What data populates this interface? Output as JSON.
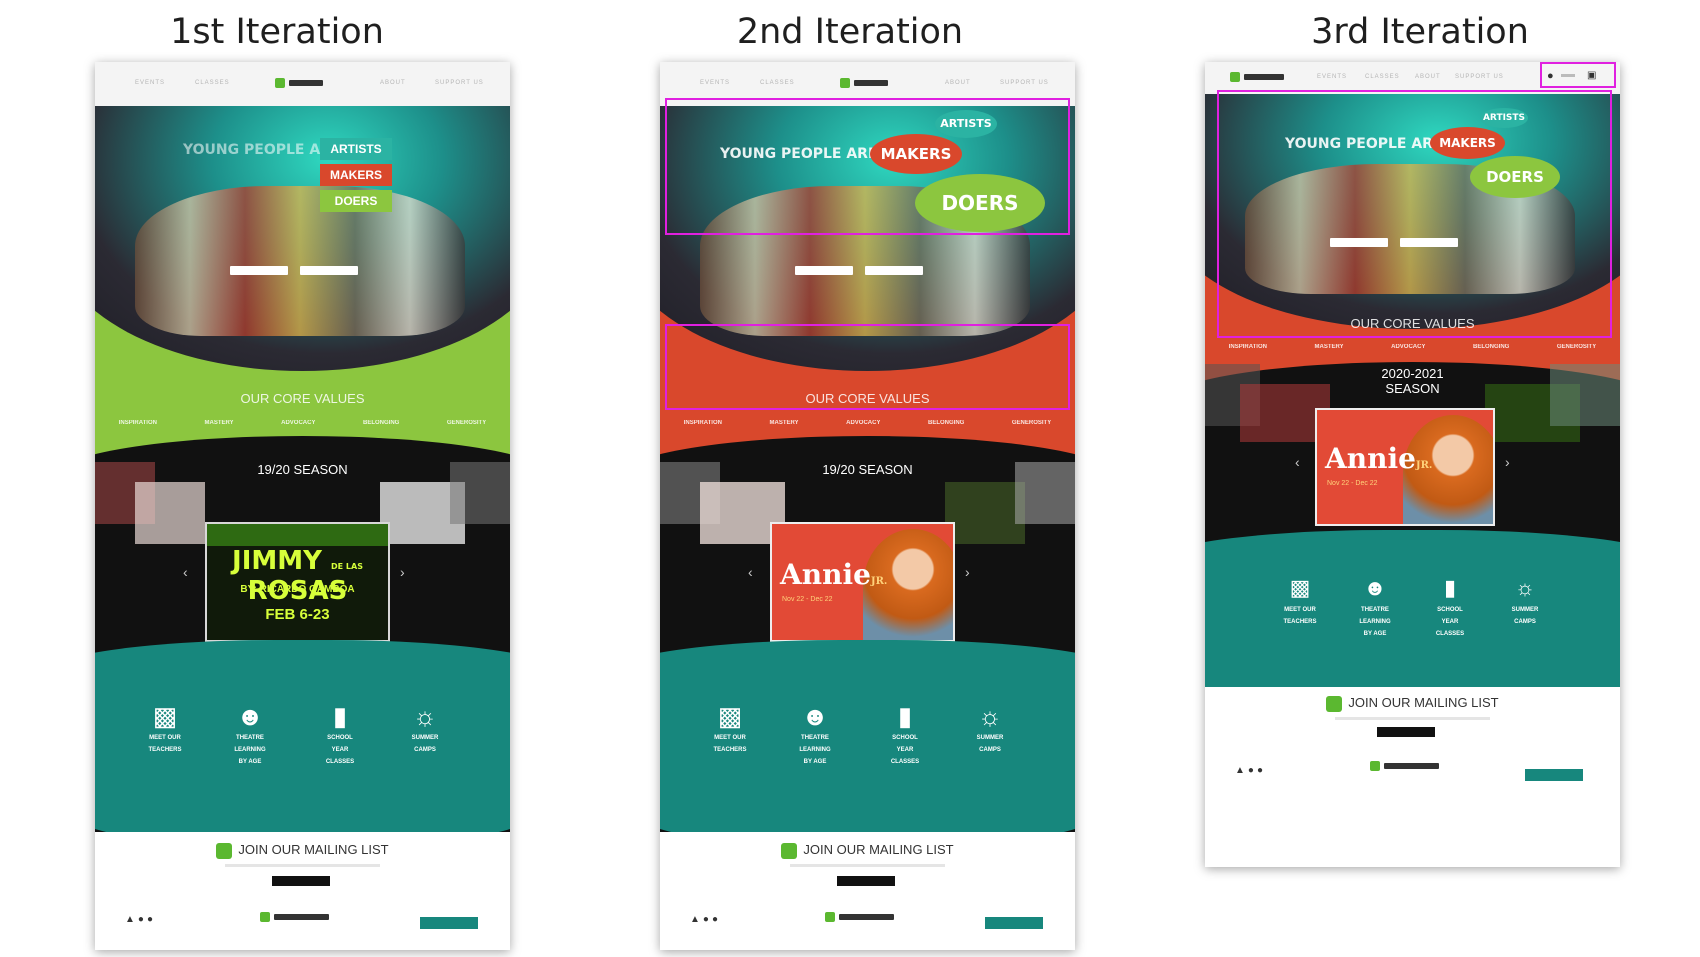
{
  "columns": [
    {
      "title": "1st Iteration"
    },
    {
      "title": "2nd Iteration"
    },
    {
      "title": "3rd Iteration"
    }
  ],
  "hero": {
    "prefix": "YOUNG PEOPLE ARE",
    "words": [
      "ARTISTS",
      "MAKERS",
      "DOERS"
    ]
  },
  "values": {
    "title": "OUR CORE VALUES",
    "items": [
      "INSPIRATION",
      "MASTERY",
      "ADVOCACY",
      "BELONGING",
      "GENEROSITY"
    ]
  },
  "season": {
    "v1": "19/20 SEASON",
    "v2": "19/20 SEASON",
    "v3_line1": "2020-2021",
    "v3_line2": "SEASON"
  },
  "posters": {
    "jimmy_title": "JIMMY",
    "jimmy_sub": "DE LAS",
    "jimmy_title2": "ROSAS",
    "jimmy_by": "BY: RICARDO GAMBOA",
    "jimmy_dates": "FEB 6-23",
    "annie_title": "Annie",
    "annie_suffix": "JR.",
    "annie_dates": "Nov 22 - Dec 22"
  },
  "features": [
    {
      "label1": "MEET OUR",
      "label2": "TEACHERS",
      "label3": "",
      "icon": "teacher-icon"
    },
    {
      "label1": "THEATRE",
      "label2": "LEARNING",
      "label3": "BY AGE",
      "icon": "theatre-masks-icon"
    },
    {
      "label1": "SCHOOL",
      "label2": "YEAR",
      "label3": "CLASSES",
      "icon": "book-icon"
    },
    {
      "label1": "SUMMER",
      "label2": "CAMPS",
      "label3": "",
      "icon": "sun-icon"
    }
  ],
  "mailing": {
    "label": "JOIN OUR MAILING LIST"
  },
  "colors": {
    "green": "#8cc63f",
    "red": "#d9482c",
    "teal": "#17877d",
    "highlight": "#e020e0"
  }
}
